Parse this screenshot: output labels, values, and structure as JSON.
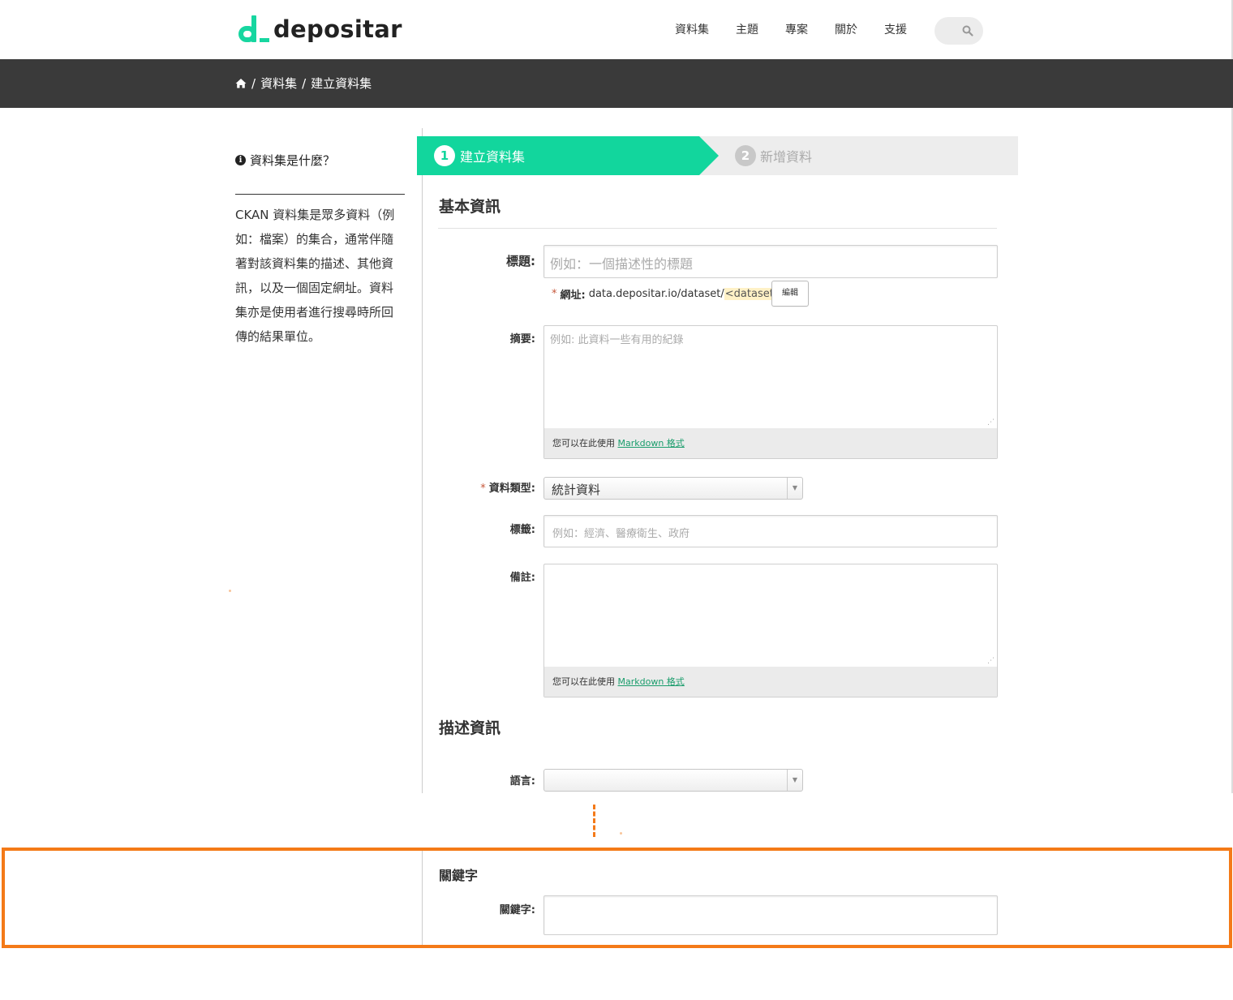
{
  "brand": {
    "name": "depositar"
  },
  "nav": {
    "items": [
      "資料集",
      "主題",
      "專案",
      "關於",
      "支援"
    ]
  },
  "breadcrumb": {
    "items": [
      "資料集",
      "建立資料集"
    ],
    "sep": "/"
  },
  "sidebar": {
    "title": "資料集是什麼？",
    "body": "CKAN 資料集是眾多資料（例如：檔案）的集合，通常伴隨著對該資料集的描述、其他資訊，以及一個固定網址。資料集亦是使用者進行搜尋時所回傳的結果單位。"
  },
  "stages": [
    {
      "num": "1",
      "label": "建立資料集",
      "active": true
    },
    {
      "num": "2",
      "label": "新增資料",
      "active": false
    }
  ],
  "form": {
    "section_basic": "基本資訊",
    "title_label": "標題:",
    "title_placeholder": "例如：一個描述性的標題",
    "url_label": "網址:",
    "url_prefix": "data.depositar.io/dataset/",
    "url_slug": "<dataset>",
    "url_edit": "編輯",
    "notes_label": "摘要:",
    "notes_placeholder": "例如: 此資料一些有用的紀錄",
    "markdown_prefix": "您可以在此使用",
    "markdown_link": "Markdown 格式",
    "type_label": "資料類型:",
    "type_value": "統計資料",
    "tags_label": "標籤:",
    "tags_placeholder": "例如：經濟、醫療衛生、政府",
    "remarks_label": "備註:",
    "section_desc": "描述資訊",
    "language_label": "語言:",
    "language_value": "",
    "section_keywords": "關鍵字",
    "keywords_label": "關鍵字:"
  },
  "colors": {
    "accent": "#12d69d",
    "highlight": "#f47a18",
    "crumbbar": "#3a3a3a"
  }
}
